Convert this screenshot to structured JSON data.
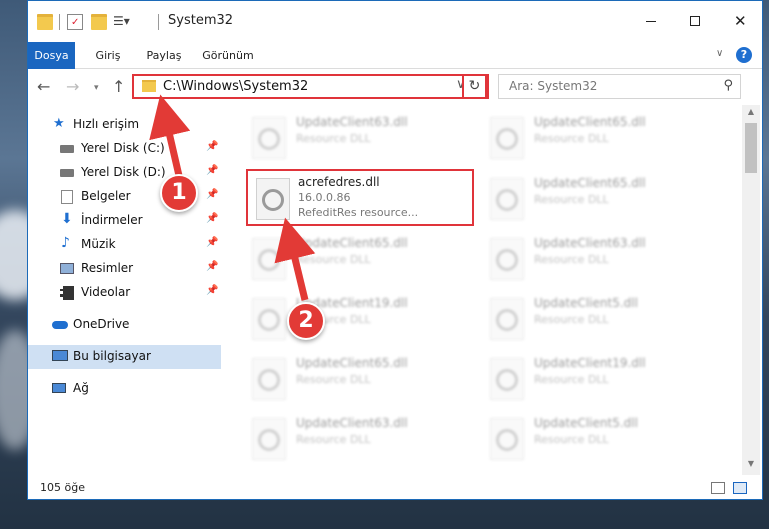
{
  "window": {
    "title": "System32",
    "controls": {
      "minimize": "–",
      "maximize": "☐",
      "close": "✕"
    }
  },
  "ribbon": {
    "tabs": [
      "Dosya",
      "Giriş",
      "Paylaş",
      "Görünüm"
    ],
    "expand_icon": "chevron-down-icon",
    "help_label": "?"
  },
  "address_bar": {
    "path": "C:\\Windows\\System32",
    "search_placeholder": "Ara: System32"
  },
  "nav_pane": {
    "quick_access": "Hızlı erişim",
    "items": [
      {
        "label": "Yerel Disk (C:)",
        "icon": "drive-icon",
        "pinned": true
      },
      {
        "label": "Yerel Disk (D:)",
        "icon": "drive-icon",
        "pinned": true
      },
      {
        "label": "Belgeler",
        "icon": "documents-icon",
        "pinned": true
      },
      {
        "label": "İndirmeler",
        "icon": "download-icon",
        "pinned": true
      },
      {
        "label": "Müzik",
        "icon": "music-icon",
        "pinned": true
      },
      {
        "label": "Resimler",
        "icon": "pictures-icon",
        "pinned": true
      },
      {
        "label": "Videolar",
        "icon": "videos-icon",
        "pinned": true
      }
    ],
    "onedrive": "OneDrive",
    "this_pc": "Bu bilgisayar",
    "network": "Ağ",
    "pin_glyph": "📌"
  },
  "files": [
    {
      "name": "UpdateClient63.dll",
      "desc": "Resource DLL"
    },
    {
      "name": "UpdateClient65.dll",
      "desc": "Resource DLL"
    },
    {
      "name": "UpdateClient65.dll",
      "desc": "Resource DLL"
    },
    {
      "name": "UpdateClient65.dll",
      "desc": "Resource DLL"
    },
    {
      "name": "UpdateClient63.dll",
      "desc": "Resource DLL"
    },
    {
      "name": "UpdateClient19.dll",
      "desc": "Resource DLL"
    },
    {
      "name": "UpdateClient5.dll",
      "desc": "Resource DLL"
    },
    {
      "name": "UpdateClient65.dll",
      "desc": "Resource DLL"
    },
    {
      "name": "UpdateClient19.dll",
      "desc": "Resource DLL"
    },
    {
      "name": "UpdateClient63.dll",
      "desc": "Resource DLL"
    },
    {
      "name": "UpdateClient5.dll",
      "desc": "Resource DLL"
    }
  ],
  "highlighted_file": {
    "name": "acrefedres.dll",
    "version": "16.0.0.86",
    "desc": "RefeditRes resource..."
  },
  "status": {
    "item_count": "105 öğe"
  },
  "callouts": {
    "one": "1",
    "two": "2"
  },
  "colors": {
    "accent": "#1a66c0",
    "highlight": "#e0343a"
  }
}
